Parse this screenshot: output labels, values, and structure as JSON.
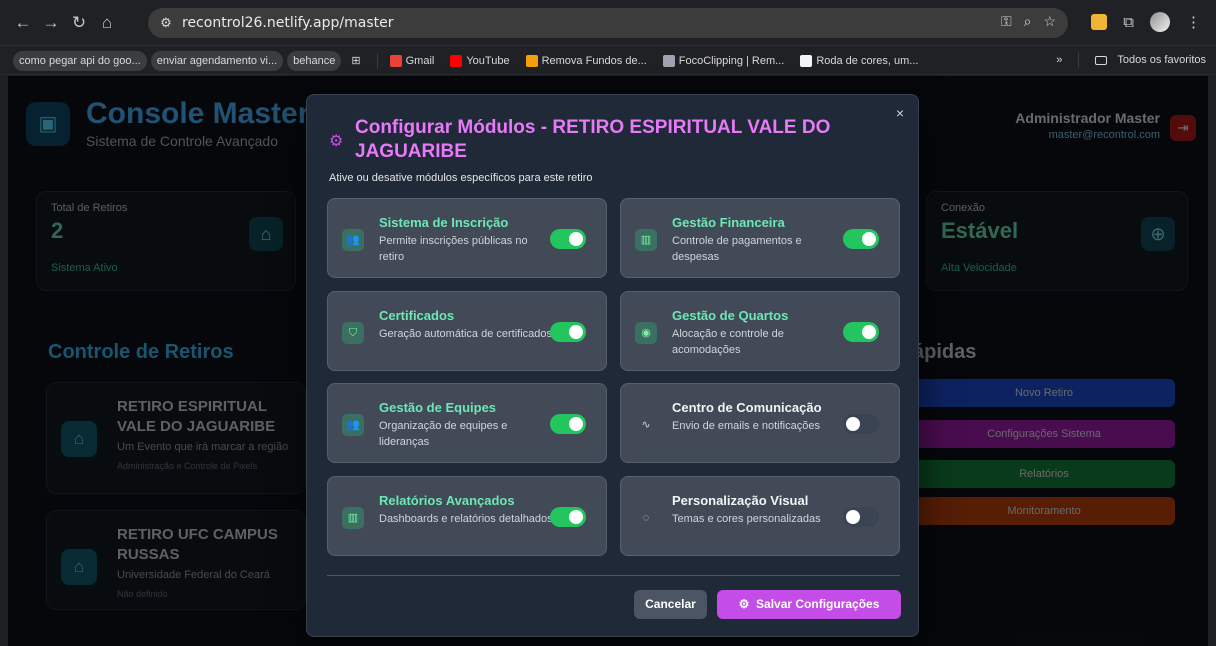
{
  "browser": {
    "url": "recontrol26.netlify.app/master",
    "bookmarks": [
      "como pegar api do goo...",
      "enviar agendamento vi...",
      "behance",
      "Gmail",
      "YouTube",
      "Remova Fundos de...",
      "FocoClipping | Rem...",
      "Roda de cores, um..."
    ],
    "all_bookmarks": "Todos os favoritos",
    "chevron": "»"
  },
  "header": {
    "title": "Console Master",
    "subtitle": "Sistema de Controle Avançado",
    "admin_name": "Administrador Master",
    "admin_email": "master@recontrol.com"
  },
  "stats": {
    "total_label": "Total de Retiros",
    "total_value": "2",
    "total_foot": "Sistema Ativo",
    "connection_label": "Conexão",
    "connection_value": "Estável",
    "connection_foot": "Alta Velocidade"
  },
  "controle": {
    "title": "Controle de Retiros",
    "retreats": [
      {
        "name": "RETIRO ESPIRITUAL VALE DO JAGUARIBE",
        "desc": "Um Evento que irá marcar a região",
        "meta": "Administração e Controle de Pixels"
      },
      {
        "name": "RETIRO UFC CAMPUS RUSSAS",
        "desc": "Universidade Federal do Ceará",
        "meta": "Não definido"
      }
    ]
  },
  "quick_actions": {
    "title": "Ações Rápidas",
    "title_visible": "ápidas",
    "buttons": [
      "Novo Retiro",
      "Configurações Sistema",
      "Relatórios",
      "Monitoramento"
    ],
    "colors": [
      "#1d4ed8",
      "#a21caf",
      "#15803d",
      "#c2410c"
    ]
  },
  "modal": {
    "title": "Configurar Módulos - RETIRO ESPIRITUAL VALE DO JAGUARIBE",
    "subtitle": "Ative ou desative módulos específicos para este retiro",
    "close_icon": "×",
    "modules": [
      {
        "name": "Sistema de Inscrição",
        "desc": "Permite inscrições públicas no retiro",
        "enabled": true,
        "icon": "users-icon"
      },
      {
        "name": "Gestão Financeira",
        "desc": "Controle de pagamentos e despesas",
        "enabled": true,
        "icon": "bar-chart-icon"
      },
      {
        "name": "Certificados",
        "desc": "Geração automática de certificados",
        "enabled": true,
        "icon": "shield-icon"
      },
      {
        "name": "Gestão de Quartos",
        "desc": "Alocação e controle de acomodações",
        "enabled": true,
        "icon": "location-pin-icon"
      },
      {
        "name": "Gestão de Equipes",
        "desc": "Organização de equipes e lideranças",
        "enabled": true,
        "icon": "users-icon"
      },
      {
        "name": "Centro de Comunicação",
        "desc": "Envio de emails e notificações",
        "enabled": false,
        "icon": "activity-icon"
      },
      {
        "name": "Relatórios Avançados",
        "desc": "Dashboards e relatórios detalhados",
        "enabled": true,
        "icon": "bar-chart-icon"
      },
      {
        "name": "Personalização Visual",
        "desc": "Temas e cores personalizadas",
        "enabled": false,
        "icon": "palette-icon"
      }
    ],
    "cancel": "Cancelar",
    "save": "Salvar Configurações"
  }
}
